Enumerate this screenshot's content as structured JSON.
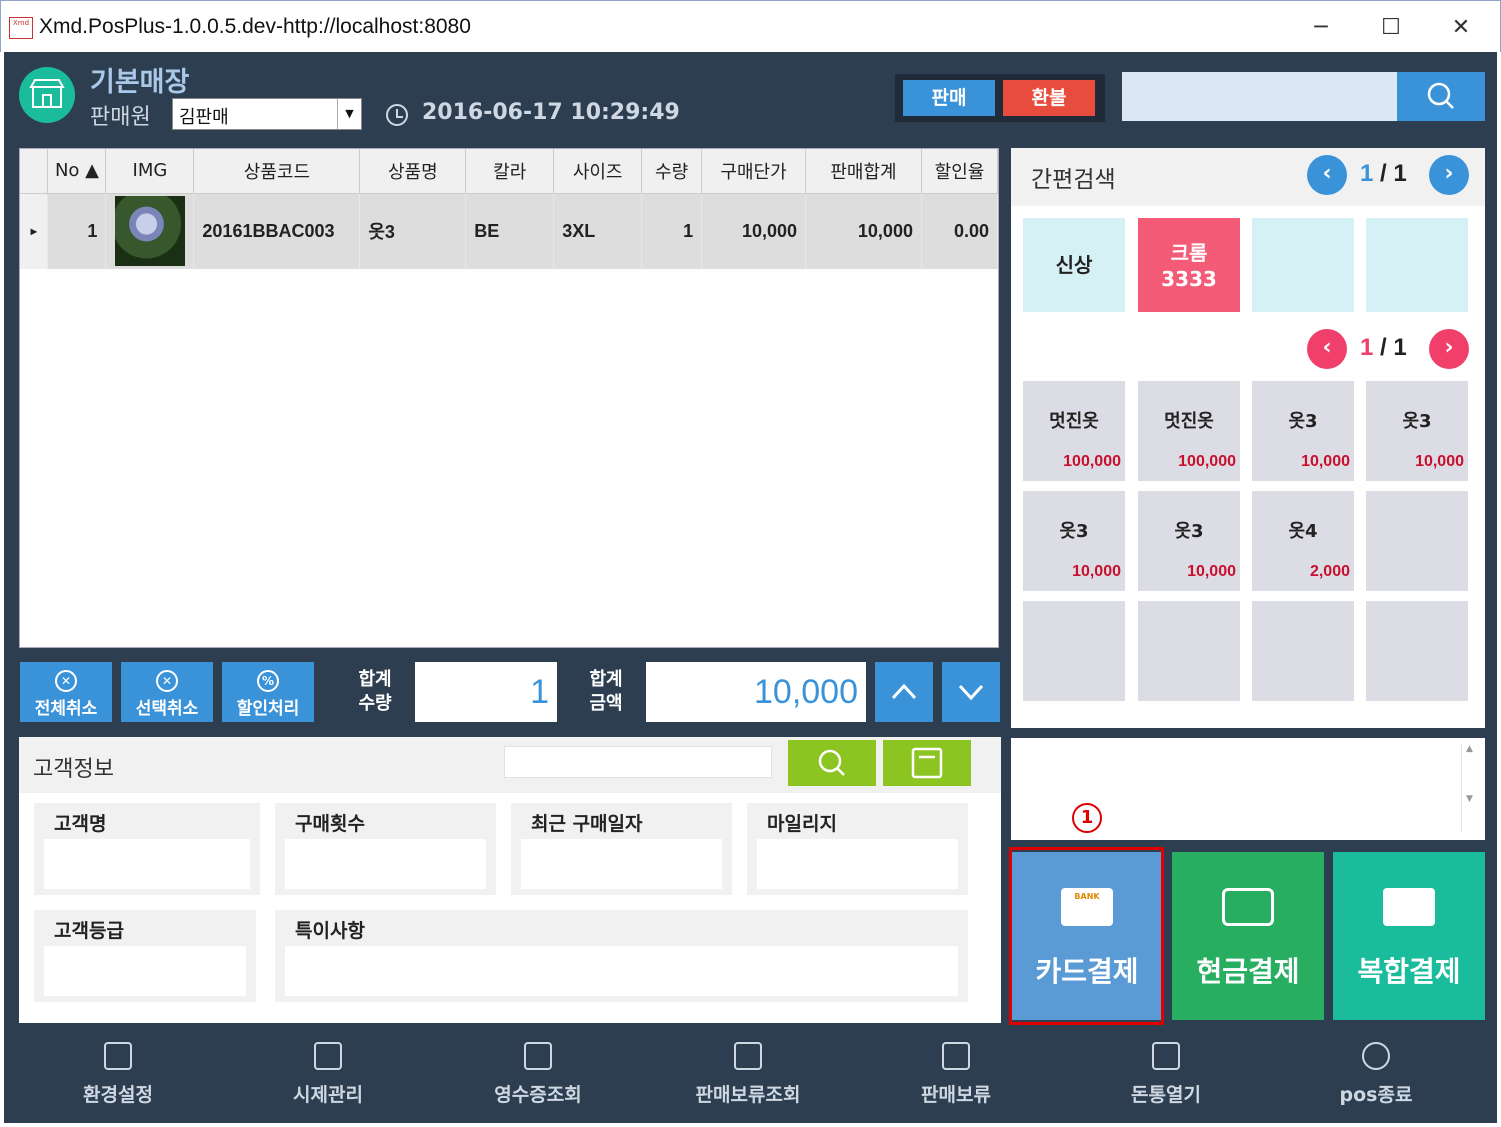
{
  "window": {
    "title": "Xmd.PosPlus-1.0.0.5.dev-http://localhost:8080",
    "minimize": "─",
    "maximize": "☐",
    "close": "✕",
    "logo_text": "Xmd"
  },
  "header": {
    "store_name": "기본매장",
    "seller_label": "판매원",
    "seller_value": "김판매",
    "datetime": "2016-06-17 10:29:49",
    "sale_button": "판매",
    "refund_button": "환불",
    "search_placeholder": ""
  },
  "grid": {
    "columns": [
      "",
      "No ▲",
      "IMG",
      "상품코드",
      "상품명",
      "칼라",
      "사이즈",
      "수량",
      "구매단가",
      "판매합계",
      "할인율"
    ],
    "rows": [
      {
        "indicator": "▸",
        "no": "1",
        "code": "20161BBAC003",
        "name": "옷3",
        "color": "BE",
        "size": "3XL",
        "qty": "1",
        "unit_price": "10,000",
        "total": "10,000",
        "discount": "0.00"
      }
    ]
  },
  "actions": {
    "cancel_all": "전체취소",
    "cancel_selected": "선택취소",
    "discount": "할인처리",
    "total_qty_label_1": "합계",
    "total_qty_label_2": "수량",
    "total_qty": "1",
    "total_amount_label_1": "합계",
    "total_amount_label_2": "금액",
    "total_amount": "10,000",
    "up": "︿",
    "down": "﹀"
  },
  "customer": {
    "title": "고객정보",
    "search_placeholder": "",
    "fields": {
      "name": "고객명",
      "purchase_count": "구매횟수",
      "last_purchase": "최근 구매일자",
      "mileage": "마일리지",
      "grade": "고객등급",
      "notes": "특이사항"
    }
  },
  "quick_search": {
    "title": "간편검색",
    "category_page": {
      "current": "1",
      "sep": " / ",
      "total": "1"
    },
    "product_page": {
      "current": "1",
      "sep": " / ",
      "total": "1"
    },
    "categories": [
      {
        "label": "신상",
        "line2": ""
      },
      {
        "label": "크롬",
        "line2": "3333"
      }
    ],
    "products": [
      {
        "name": "멋진옷",
        "price": "100,000"
      },
      {
        "name": "멋진옷",
        "price": "100,000"
      },
      {
        "name": "옷3",
        "price": "10,000"
      },
      {
        "name": "옷3",
        "price": "10,000"
      },
      {
        "name": "옷3",
        "price": "10,000"
      },
      {
        "name": "옷3",
        "price": "10,000"
      },
      {
        "name": "옷4",
        "price": "2,000"
      }
    ],
    "prev": "‹",
    "next": "›"
  },
  "payment": {
    "marker": "1",
    "card": "카드결제",
    "cash": "현금결제",
    "mixed": "복합결제",
    "card_icon_text": "BANK"
  },
  "footer": {
    "items": [
      "환경설정",
      "시제관리",
      "영수증조회",
      "판매보류조회",
      "판매보류",
      "돈통열기",
      "pos종료"
    ]
  },
  "colors": {
    "dark_bg": "#2d3e50",
    "blue": "#3a93d9",
    "red": "#e74c3c",
    "pink": "#f45b77",
    "light_cyan": "#d6f1f6",
    "green_card": "#27ae60",
    "teal": "#1abc9c",
    "price_red": "#c8102e",
    "highlight_red": "#e00000"
  }
}
